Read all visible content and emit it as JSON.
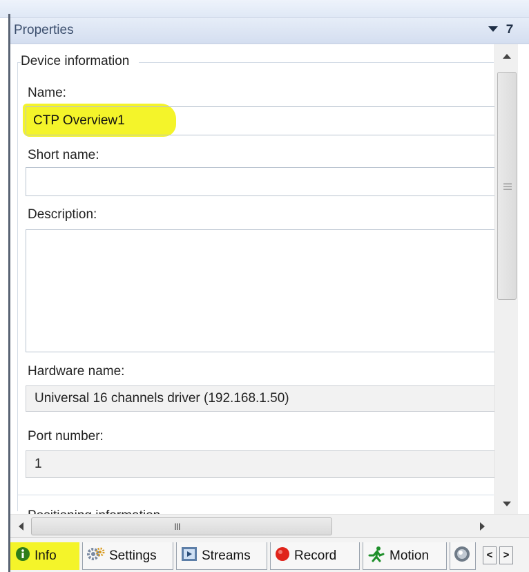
{
  "panel": {
    "title": "Properties"
  },
  "group": {
    "title": "Device information"
  },
  "fields": {
    "name_label": "Name:",
    "name_value": "CTP Overview1",
    "short_name_label": "Short name:",
    "short_name_value": "",
    "description_label": "Description:",
    "description_value": "",
    "hardware_name_label": "Hardware name:",
    "hardware_name_value": "Universal 16 channels driver (192.168.1.50)",
    "port_number_label": "Port number:",
    "port_number_value": "1"
  },
  "cut_off_text": "Positioning information",
  "hscroll": {
    "grip": "III"
  },
  "tabs": [
    {
      "label": "Info",
      "icon": "info-icon",
      "active": true
    },
    {
      "label": "Settings",
      "icon": "settings-icon",
      "active": false
    },
    {
      "label": "Streams",
      "icon": "streams-icon",
      "active": false
    },
    {
      "label": "Record",
      "icon": "record-icon",
      "active": false
    },
    {
      "label": "Motion",
      "icon": "motion-icon",
      "active": false
    }
  ],
  "nav": {
    "prev": "<",
    "next": ">"
  },
  "colors": {
    "highlight": "#f4f42a",
    "record_red": "#e0241b",
    "motion_green": "#1e8f2a",
    "info_green": "#2f7d1a"
  }
}
